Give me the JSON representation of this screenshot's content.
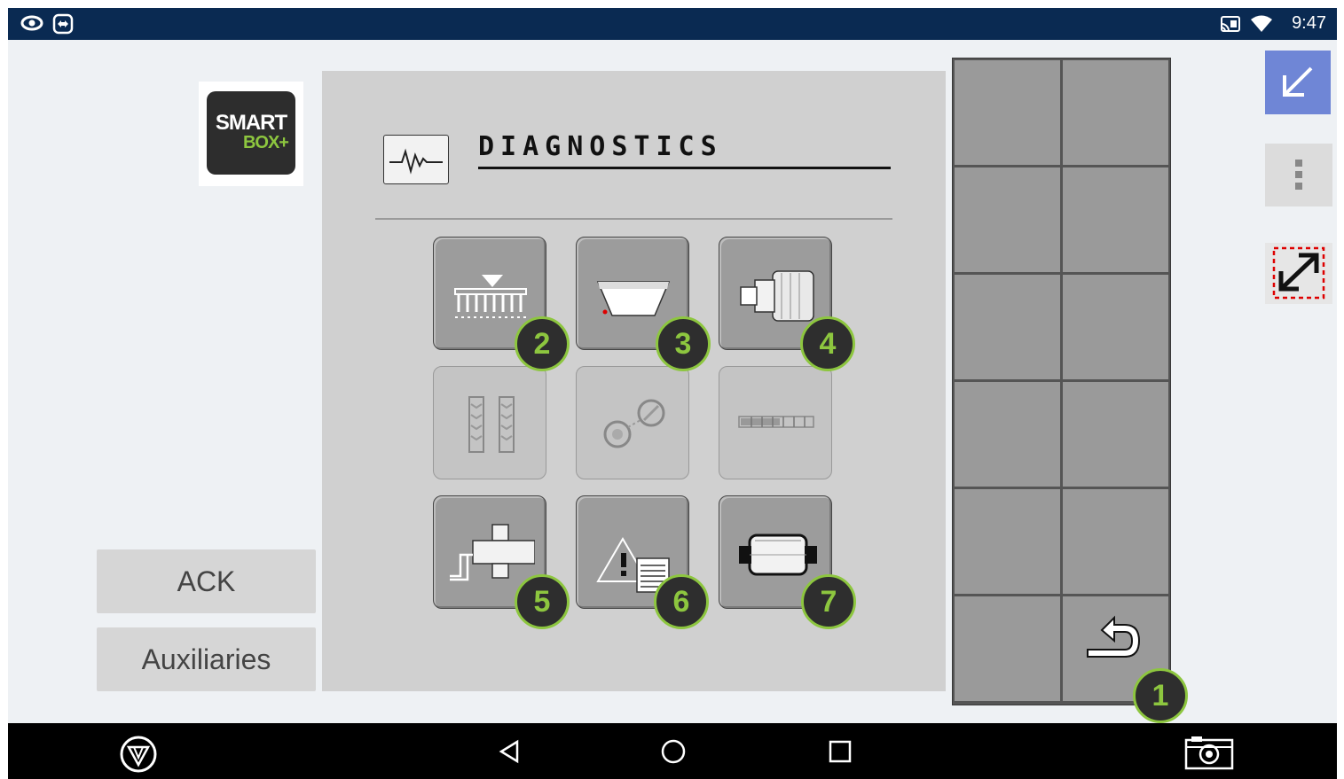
{
  "status_bar": {
    "time": "9:47"
  },
  "logo": {
    "line1": "SMART",
    "line2": "BOX+"
  },
  "side_buttons": {
    "ack": "ACK",
    "auxiliaries": "Auxiliaries"
  },
  "panel": {
    "title": "DIAGNOSTICS"
  },
  "callouts": [
    "1",
    "2",
    "3",
    "4",
    "5",
    "6",
    "7"
  ],
  "tiles": [
    {
      "icon": "seed-drill-icon",
      "enabled": true
    },
    {
      "icon": "hopper-icon",
      "enabled": true
    },
    {
      "icon": "fan-motor-icon",
      "enabled": true
    },
    {
      "icon": "tramline-icon",
      "enabled": false
    },
    {
      "icon": "calibration-icon",
      "enabled": false
    },
    {
      "icon": "section-bar-icon",
      "enabled": false
    },
    {
      "icon": "sensor-valve-icon",
      "enabled": true
    },
    {
      "icon": "alarm-log-icon",
      "enabled": true
    },
    {
      "icon": "metering-roller-icon",
      "enabled": true
    }
  ],
  "colors": {
    "status_bar": "#0a2a52",
    "badge_ring": "#8dc63f",
    "badge_fill": "#2e2e2e",
    "accent_button": "#6f86d6"
  }
}
